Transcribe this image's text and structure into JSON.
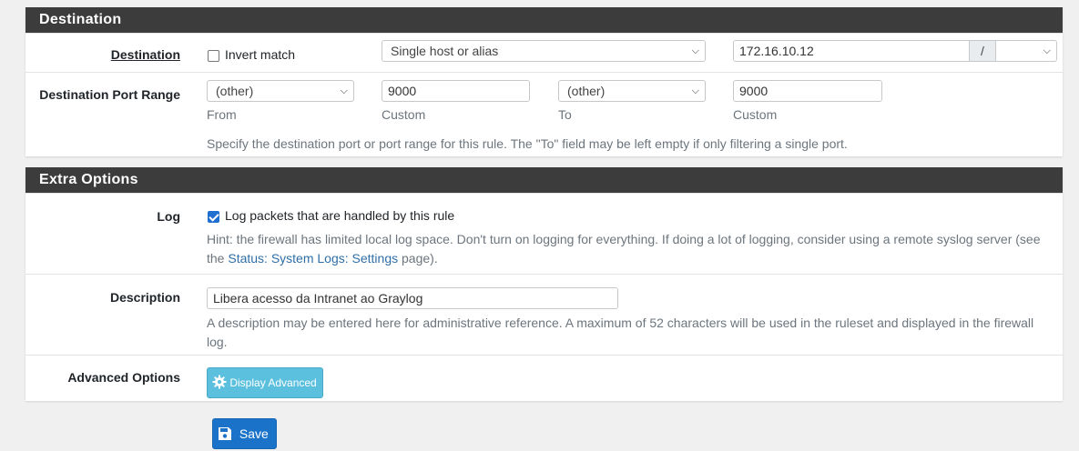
{
  "destination_panel": {
    "heading": "Destination",
    "destination_row": {
      "label": "Destination",
      "invert_label": "Invert match",
      "type_value": "Single host or alias",
      "address_value": "172.16.10.12",
      "slash": "/",
      "mask_value": ""
    },
    "port_row": {
      "label": "Destination Port Range",
      "from_select": "(other)",
      "from_custom": "9000",
      "to_select": "(other)",
      "to_custom": "9000",
      "from_label": "From",
      "custom_label_1": "Custom",
      "to_label": "To",
      "custom_label_2": "Custom",
      "help": "Specify the destination port or port range for this rule. The \"To\" field may be left empty if only filtering a single port."
    }
  },
  "extra_panel": {
    "heading": "Extra Options",
    "log_row": {
      "label": "Log",
      "checkbox_label": "Log packets that are handled by this rule",
      "checked": true,
      "hint_pre": "Hint: the firewall has limited local log space. Don't turn on logging for everything. If doing a lot of logging, consider using a remote syslog server (see the ",
      "hint_link": "Status: System Logs: Settings",
      "hint_post": " page)."
    },
    "description_row": {
      "label": "Description",
      "value": "Libera acesso da Intranet ao Graylog",
      "help": "A description may be entered here for administrative reference. A maximum of 52 characters will be used in the ruleset and displayed in the firewall log."
    },
    "advanced_row": {
      "label": "Advanced Options",
      "button_label": "Display Advanced"
    }
  },
  "save_button_label": "Save",
  "colors": {
    "panel_heading_bg": "#3c3c3c",
    "info_button": "#5bc0de",
    "primary_button": "#1a73c9",
    "link": "#2f6fa8"
  },
  "icons": [
    "chevron-down-icon",
    "gear-icon",
    "save-icon",
    "checkmark-icon"
  ]
}
